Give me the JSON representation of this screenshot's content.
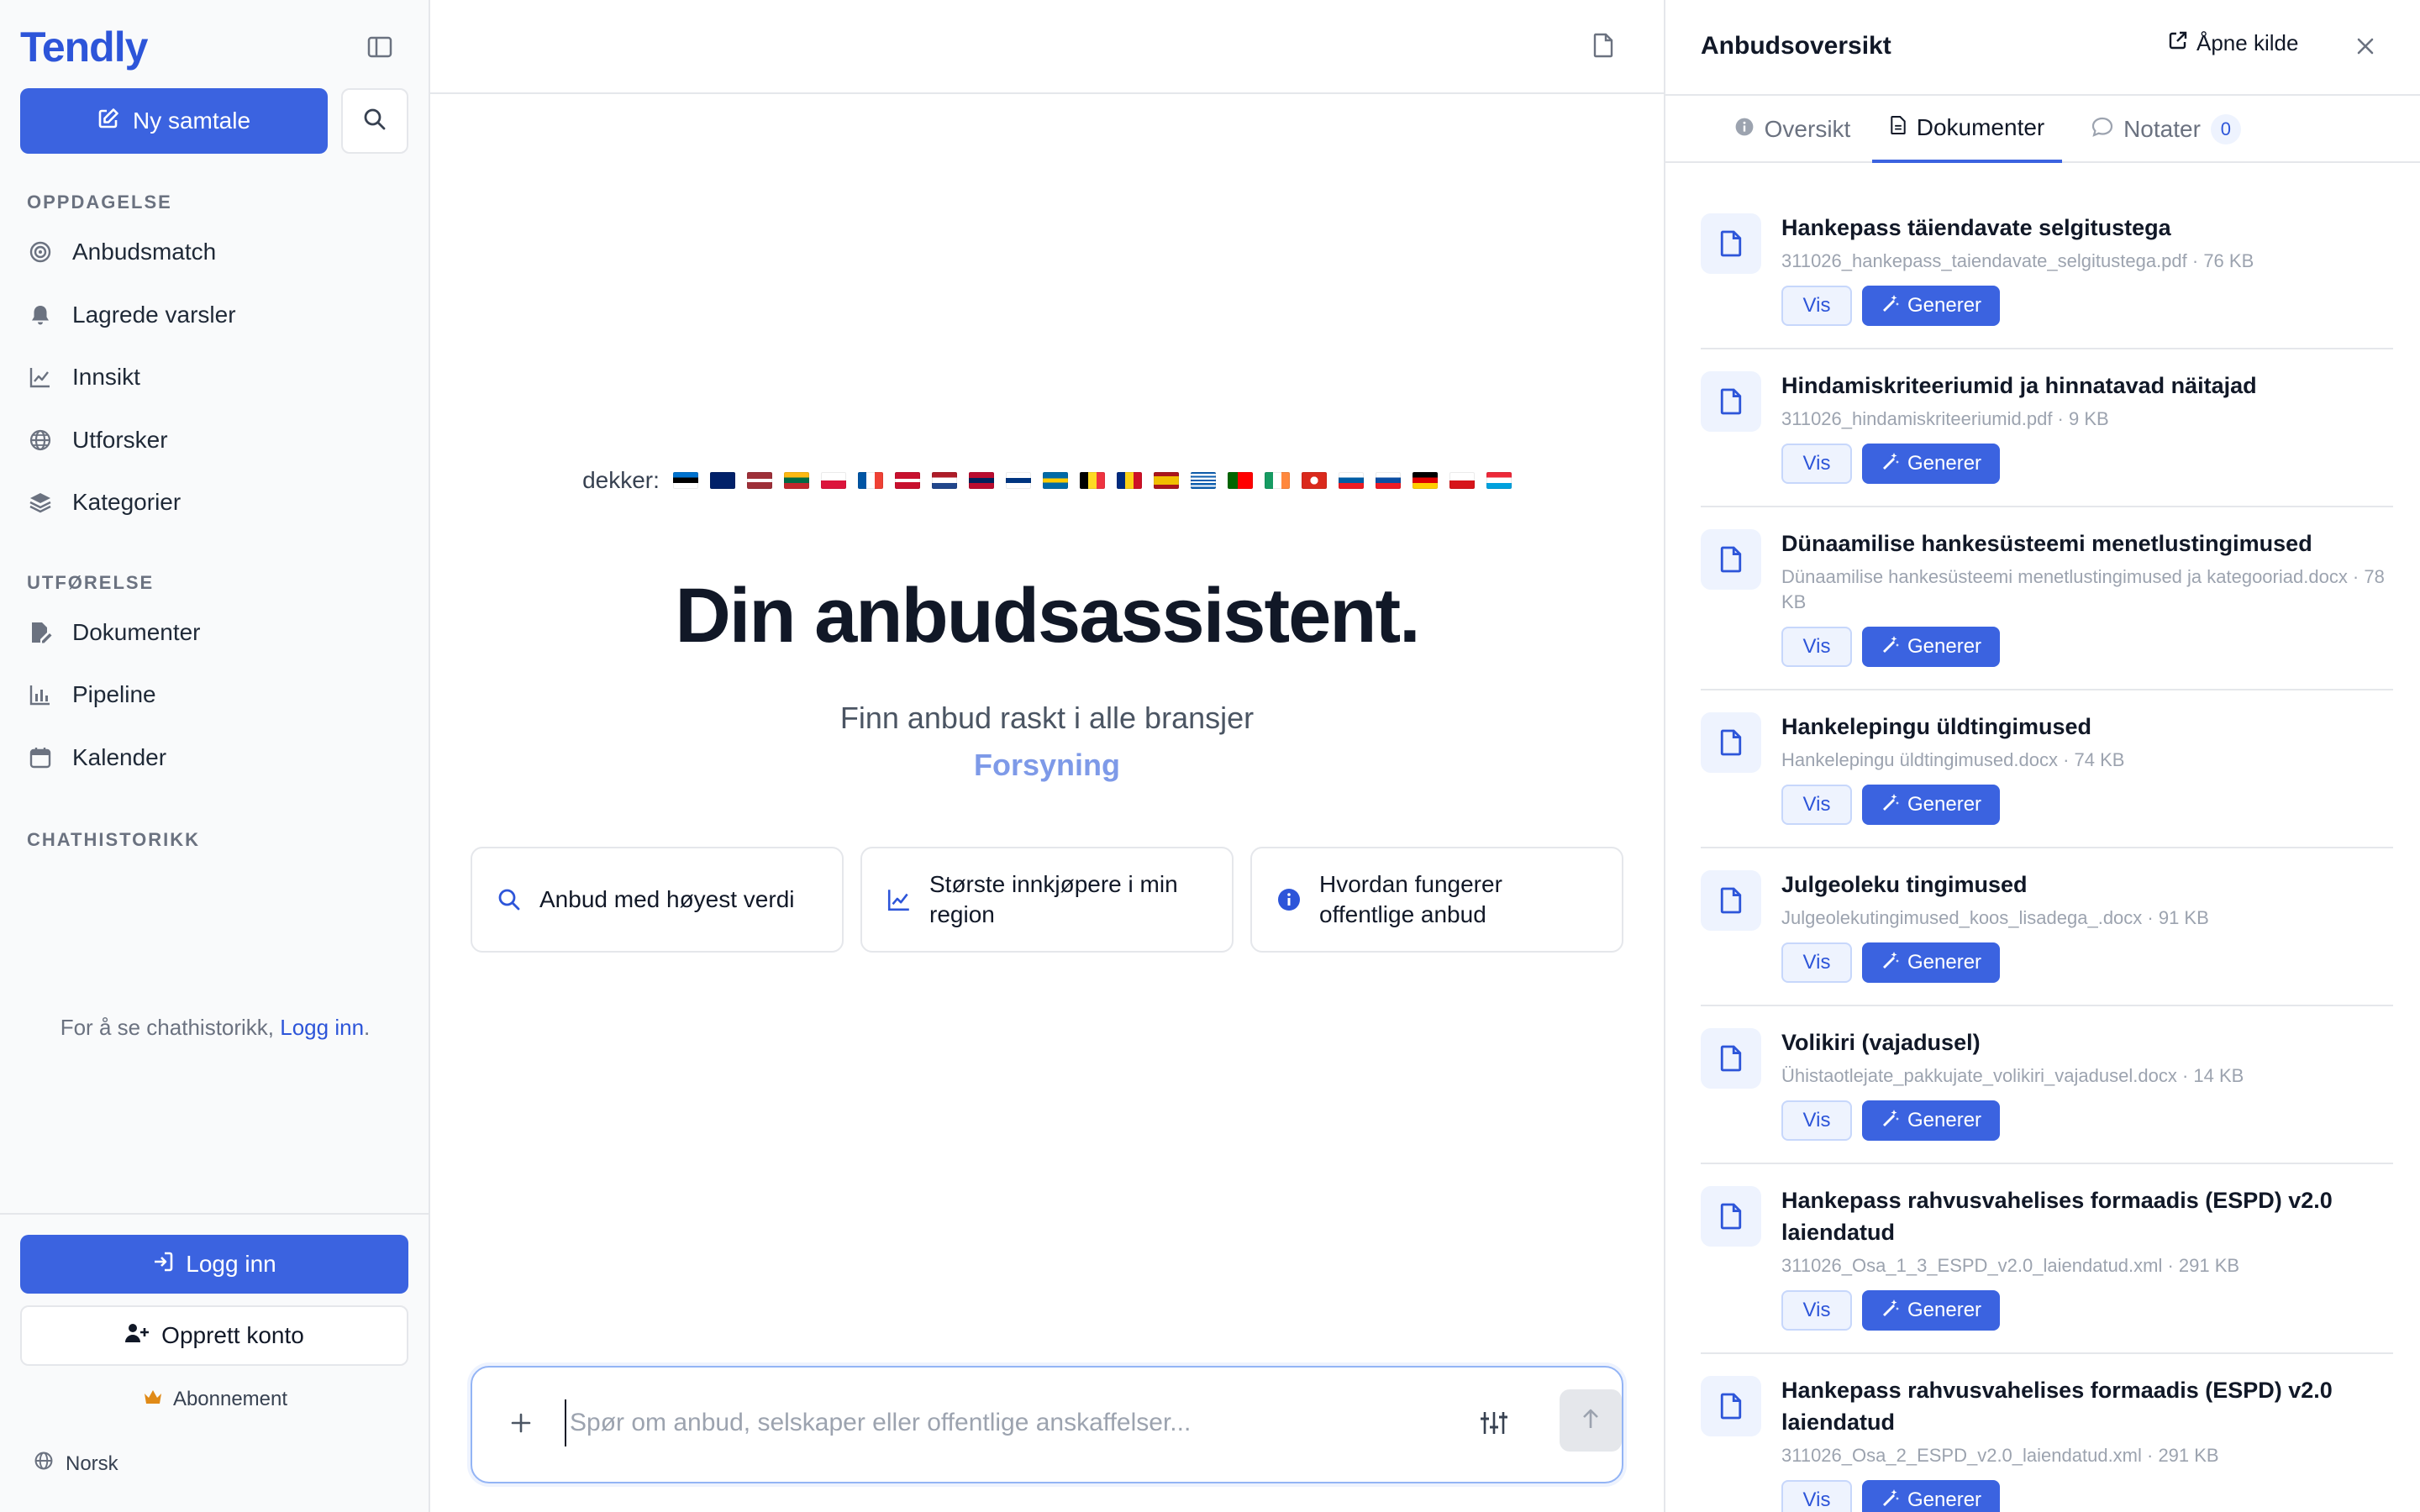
{
  "sidebar": {
    "logo": "Tendly",
    "new_chat_label": "Ny samtale",
    "sections": {
      "discovery": "OPPDAGELSE",
      "execution": "UTFØRELSE",
      "history": "CHATHISTORIKK"
    },
    "discovery_items": [
      {
        "label": "Anbudsmatch",
        "icon": "target-icon"
      },
      {
        "label": "Lagrede varsler",
        "icon": "bell-icon"
      },
      {
        "label": "Innsikt",
        "icon": "chart-line-icon"
      },
      {
        "label": "Utforsker",
        "icon": "globe-icon"
      },
      {
        "label": "Kategorier",
        "icon": "layers-icon"
      }
    ],
    "execution_items": [
      {
        "label": "Dokumenter",
        "icon": "document-edit-icon"
      },
      {
        "label": "Pipeline",
        "icon": "bar-chart-icon"
      },
      {
        "label": "Kalender",
        "icon": "calendar-icon"
      }
    ],
    "history_note_prefix": "For å se chathistorikk,",
    "history_note_link": "Logg inn",
    "history_note_suffix": ".",
    "login_label": "Logg inn",
    "signup_label": "Opprett konto",
    "subscription_label": "Abonnement",
    "language_label": "Norsk"
  },
  "main": {
    "covers_label": "dekker:",
    "flags": [
      "EE",
      "GB",
      "LV",
      "LT",
      "PL",
      "FR",
      "DK",
      "NL",
      "NO",
      "FI",
      "SE",
      "BE",
      "RO",
      "ES",
      "GR",
      "PT",
      "IE",
      "CH",
      "SI",
      "SK",
      "DE",
      "CZ",
      "LU"
    ],
    "hero_title": "Din anbudsassistent.",
    "hero_subtitle": "Finn anbud raskt i alle bransjer",
    "hero_rotating": "Forsyning",
    "suggestions": [
      {
        "label": "Anbud med høyest verdi",
        "icon": "search-icon"
      },
      {
        "label": "Største innkjøpere i min region",
        "icon": "trend-icon"
      },
      {
        "label": "Hvordan fungerer offentlige anbud",
        "icon": "info-icon"
      }
    ],
    "composer_placeholder": "Spør om anbud, selskaper eller offentlige anskaffelser..."
  },
  "panel": {
    "title": "Anbudsoversikt",
    "open_source_label": "Åpne kilde",
    "tabs": [
      {
        "label": "Oversikt",
        "icon": "info-icon"
      },
      {
        "label": "Dokumenter",
        "icon": "file-icon"
      },
      {
        "label": "Notater",
        "icon": "comment-icon",
        "count": "0"
      }
    ],
    "view_label": "Vis",
    "generate_label": "Generer",
    "documents": [
      {
        "name": "Hankepass täiendavate selgitustega",
        "meta": "311026_hankepass_taiendavate_selgitustega.pdf · 76 KB"
      },
      {
        "name": "Hindamiskriteeriumid ja hinnatavad näitajad",
        "meta": "311026_hindamiskriteeriumid.pdf · 9 KB"
      },
      {
        "name": "Dünaamilise hankesüsteemi menetlustingimused",
        "meta": "Dünaamilise hankesüsteemi menetlustingimused ja kategooriad.docx · 78 KB"
      },
      {
        "name": "Hankelepingu üldtingimused",
        "meta": "Hankelepingu üldtingimused.docx · 74 KB"
      },
      {
        "name": "Julgeoleku tingimused",
        "meta": "Julgeolekutingimused_koos_lisadega_.docx · 91 KB"
      },
      {
        "name": "Volikiri (vajadusel)",
        "meta": "Ühistaotlejate_pakkujate_volikiri_vajadusel.docx · 14 KB"
      },
      {
        "name": "Hankepass rahvusvahelises formaadis (ESPD) v2.0 laiendatud",
        "meta": "311026_Osa_1_3_ESPD_v2.0_laiendatud.xml · 291 KB"
      },
      {
        "name": "Hankepass rahvusvahelises formaadis (ESPD) v2.0 laiendatud",
        "meta": "311026_Osa_2_ESPD_v2.0_laiendatud.xml · 291 KB"
      }
    ]
  }
}
